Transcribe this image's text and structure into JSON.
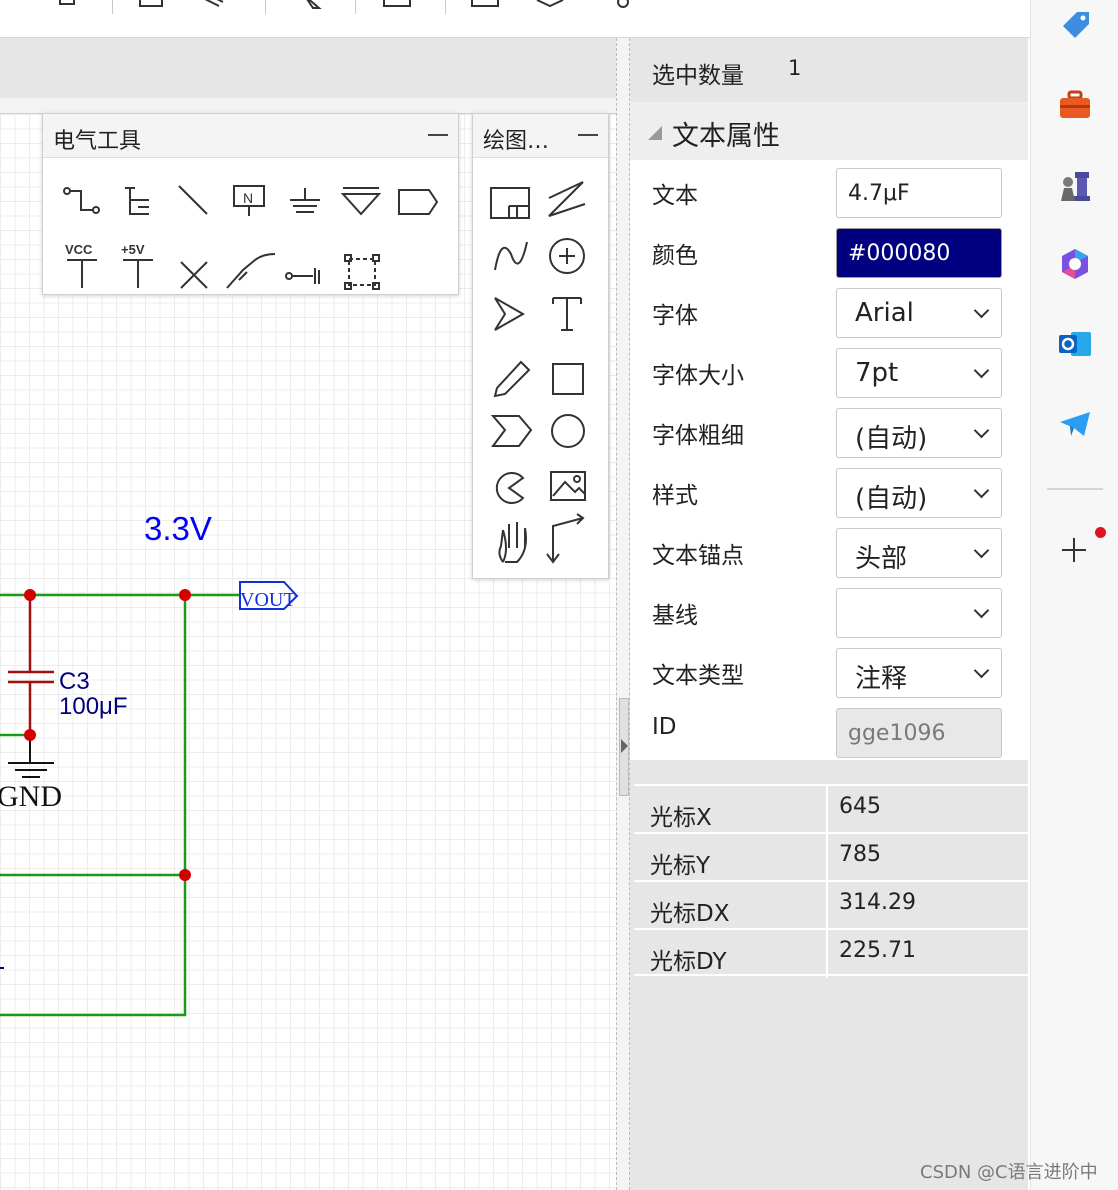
{
  "electrical_tools_panel": {
    "title": "电气工具",
    "vcc_label": "VCC",
    "plus5v_label": "+5V",
    "net_label_char": "N"
  },
  "drawing_panel": {
    "title": "绘图…"
  },
  "schematic": {
    "voltage_label": "3.3V",
    "vout_label": "VOUT",
    "cap_ref": "C3",
    "cap_value": "100μF",
    "gnd_label": "GND",
    "wire_color": "#1a9a1a",
    "junction_color": "#d40000",
    "label_color": "#0000ff"
  },
  "properties": {
    "selected_count_label": "选中数量",
    "selected_count_value": "1",
    "section_title": "文本属性",
    "fields": {
      "text": {
        "label": "文本",
        "value": "4.7μF"
      },
      "color": {
        "label": "颜色",
        "value": "#000080"
      },
      "font": {
        "label": "字体",
        "value": "Arial"
      },
      "font_size": {
        "label": "字体大小",
        "value": "7pt"
      },
      "font_weight": {
        "label": "字体粗细",
        "value": "(自动)"
      },
      "style": {
        "label": "样式",
        "value": "(自动)"
      },
      "anchor": {
        "label": "文本锚点",
        "value": "头部"
      },
      "baseline": {
        "label": "基线",
        "value": ""
      },
      "text_type": {
        "label": "文本类型",
        "value": "注释"
      },
      "id": {
        "label": "ID",
        "value": "gge1096"
      }
    },
    "cursor": [
      {
        "label": "光标X",
        "value": "645"
      },
      {
        "label": "光标Y",
        "value": "785"
      },
      {
        "label": "光标DX",
        "value": "314.29"
      },
      {
        "label": "光标DY",
        "value": "225.71"
      }
    ]
  },
  "sidebar_icons": [
    "tag-icon",
    "toolbox-icon",
    "chess-icon",
    "copilot-icon",
    "outlook-icon",
    "telegram-icon",
    "add-icon"
  ],
  "watermark": "CSDN @C语言进阶中"
}
